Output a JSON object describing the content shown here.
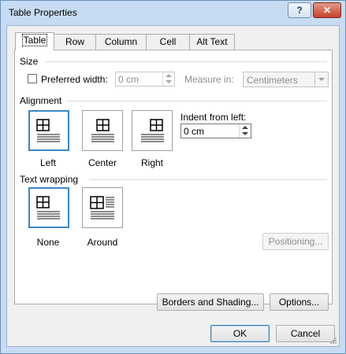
{
  "window": {
    "title": "Table Properties",
    "help_label": "?",
    "close_label": "✕"
  },
  "tabs": [
    {
      "label": "Table",
      "active": true
    },
    {
      "label": "Row",
      "active": false
    },
    {
      "label": "Column",
      "active": false
    },
    {
      "label": "Cell",
      "active": false
    },
    {
      "label": "Alt Text",
      "active": false
    }
  ],
  "size": {
    "heading": "Size",
    "preferred_width_label": "Preferred width:",
    "preferred_width_checked": false,
    "preferred_width_value": "0 cm",
    "measure_in_label": "Measure in:",
    "measure_in_value": "Centimeters"
  },
  "alignment": {
    "heading": "Alignment",
    "options": [
      {
        "label": "Left",
        "selected": true
      },
      {
        "label": "Center",
        "selected": false
      },
      {
        "label": "Right",
        "selected": false
      }
    ],
    "indent_label": "Indent from left:",
    "indent_value": "0 cm"
  },
  "text_wrapping": {
    "heading": "Text wrapping",
    "options": [
      {
        "label": "None",
        "selected": true
      },
      {
        "label": "Around",
        "selected": false
      }
    ],
    "positioning_label": "Positioning..."
  },
  "buttons": {
    "borders_shading": "Borders and Shading...",
    "options": "Options...",
    "ok": "OK",
    "cancel": "Cancel"
  },
  "colors": {
    "selection_accent": "#3c88c7",
    "title_bar": "#c7dcf2",
    "close_button": "#c7412b"
  }
}
